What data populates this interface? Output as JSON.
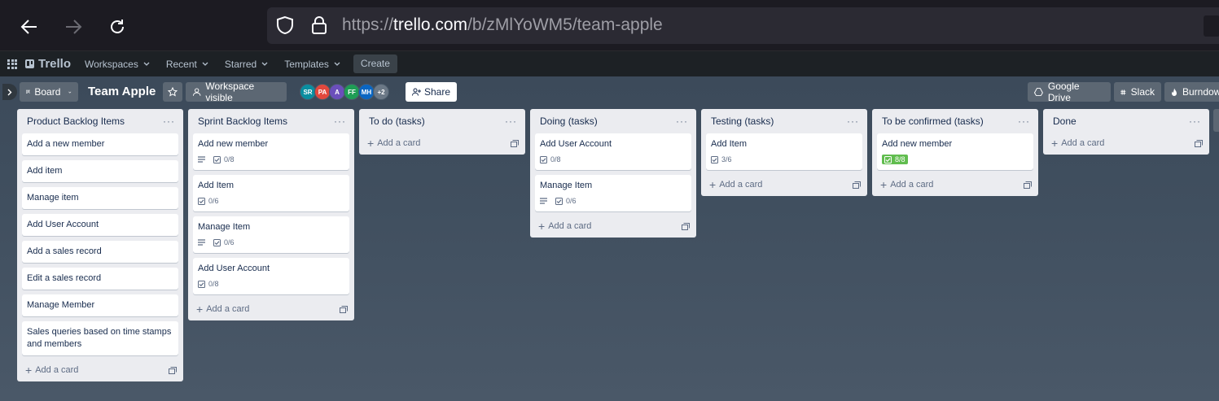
{
  "browser": {
    "url_prefix": "https://",
    "url_host": "trello.com",
    "url_path": "/b/zMlYoWM5/team-apple"
  },
  "header": {
    "logo": "Trello",
    "menus": [
      "Workspaces",
      "Recent",
      "Starred",
      "Templates"
    ],
    "create_label": "Create"
  },
  "board": {
    "view_label": "Board",
    "title": "Team Apple",
    "visibility_label": "Workspace visible",
    "share_label": "Share",
    "members": [
      {
        "initials": "SR",
        "color": "#0a8ea0"
      },
      {
        "initials": "PA",
        "color": "#e2483d"
      },
      {
        "initials": "A",
        "color": "#6b4fbb"
      },
      {
        "initials": "FF",
        "color": "#1f9d55"
      },
      {
        "initials": "MH",
        "color": "#0a66c2"
      },
      {
        "initials": "+2",
        "color": "#6b7886"
      }
    ],
    "powerups": [
      "Google Drive",
      "Slack",
      "Burndow"
    ]
  },
  "add_card_label": "Add a card",
  "lists": [
    {
      "title": "Product Backlog Items",
      "cards": [
        {
          "title": "Add a new member"
        },
        {
          "title": "Add item"
        },
        {
          "title": "Manage item"
        },
        {
          "title": "Add User Account"
        },
        {
          "title": "Add a sales record"
        },
        {
          "title": "Edit a sales record"
        },
        {
          "title": "Manage Member"
        },
        {
          "title": "Sales queries based on time stamps and members"
        }
      ]
    },
    {
      "title": "Sprint Backlog Items",
      "cards": [
        {
          "title": "Add new member",
          "description": true,
          "checklist": "0/8"
        },
        {
          "title": "Add Item",
          "checklist": "0/6"
        },
        {
          "title": "Manage Item",
          "description": true,
          "checklist": "0/6"
        },
        {
          "title": "Add User Account",
          "checklist": "0/8"
        }
      ]
    },
    {
      "title": "To do (tasks)",
      "cards": []
    },
    {
      "title": "Doing (tasks)",
      "cards": [
        {
          "title": "Add User Account",
          "checklist": "0/8"
        },
        {
          "title": "Manage Item",
          "description": true,
          "checklist": "0/6"
        }
      ]
    },
    {
      "title": "Testing (tasks)",
      "cards": [
        {
          "title": "Add Item",
          "checklist": "3/6"
        }
      ]
    },
    {
      "title": "To be confirmed (tasks)",
      "cards": [
        {
          "title": "Add new member",
          "checklist": "8/8",
          "complete": true
        }
      ]
    },
    {
      "title": "Done",
      "cards": []
    }
  ]
}
